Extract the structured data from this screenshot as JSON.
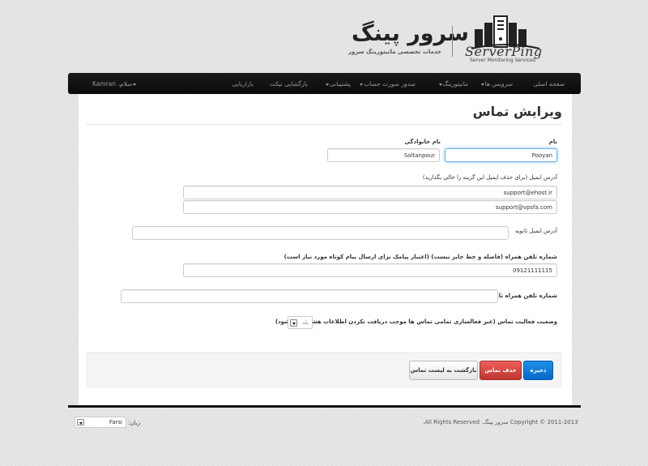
{
  "logo": {
    "fa_title": "سرور پینگ",
    "fa_subtitle": "خدمات تخصصی مانیتورینگ سرور",
    "en_title": "ServerPing",
    "en_subtitle": "Server Monitoring Services",
    "icon": "server-racks-icon"
  },
  "nav": {
    "items": [
      {
        "label": "صفحه اصلی",
        "dropdown": false
      },
      {
        "label": "سرویس ها",
        "dropdown": true
      },
      {
        "label": "مانیتورینگ",
        "dropdown": true
      },
      {
        "label": "صدور صورت حساب",
        "dropdown": true
      },
      {
        "label": "پشتیبانی",
        "dropdown": true
      },
      {
        "label": "بازگشایی تیکت",
        "dropdown": false
      },
      {
        "label": "بازاریابی",
        "dropdown": false
      }
    ],
    "greeting": "سلام، Kamran"
  },
  "page": {
    "title": "ویرایش تماس"
  },
  "form": {
    "first_name_label": "نام",
    "first_name_value": "Pooyan",
    "last_name_label": "نام خانوادگی",
    "last_name_value": "Soltanpour",
    "email_label": "آدرس ایمیل (برای حذف ایمیل این گزینه را خالی بگذارید)",
    "email_1": "support@ehost.ir",
    "email_2": "support@vpsfa.com",
    "secondary_email_label": "آدرس ایمیل ثانویه",
    "secondary_email_value": "",
    "mobile_label": "شماره تلفن همراه (فاصله و خط جایز نیست) (اعتبار پیامک برای ارسال پیام کوتاه مورد نیاز است)",
    "mobile_value": "09121111115",
    "secondary_mobile_label": "شماره تلفن همراه ثانویه",
    "secondary_mobile_value": "",
    "status_label": "وضعیت فعالیت تماس (غیر فعالسازی تمامی تماس ها موجب دریافت نکردن اطلاعات هشدار می شود)",
    "status_value": "بله"
  },
  "actions": {
    "save": "ذخیره",
    "delete": "حذف تماس",
    "back": "بازگشت به لیست تماس"
  },
  "footer": {
    "copyright": "Copyright © 2011-2013 سرور پینگ. All Rights Reserved.",
    "language_label": "زبان:",
    "language_value": "Farsi"
  },
  "colors": {
    "save": "#0a73d6",
    "delete": "#d9534f",
    "navbar": "#111111",
    "focus": "#66afe9"
  }
}
